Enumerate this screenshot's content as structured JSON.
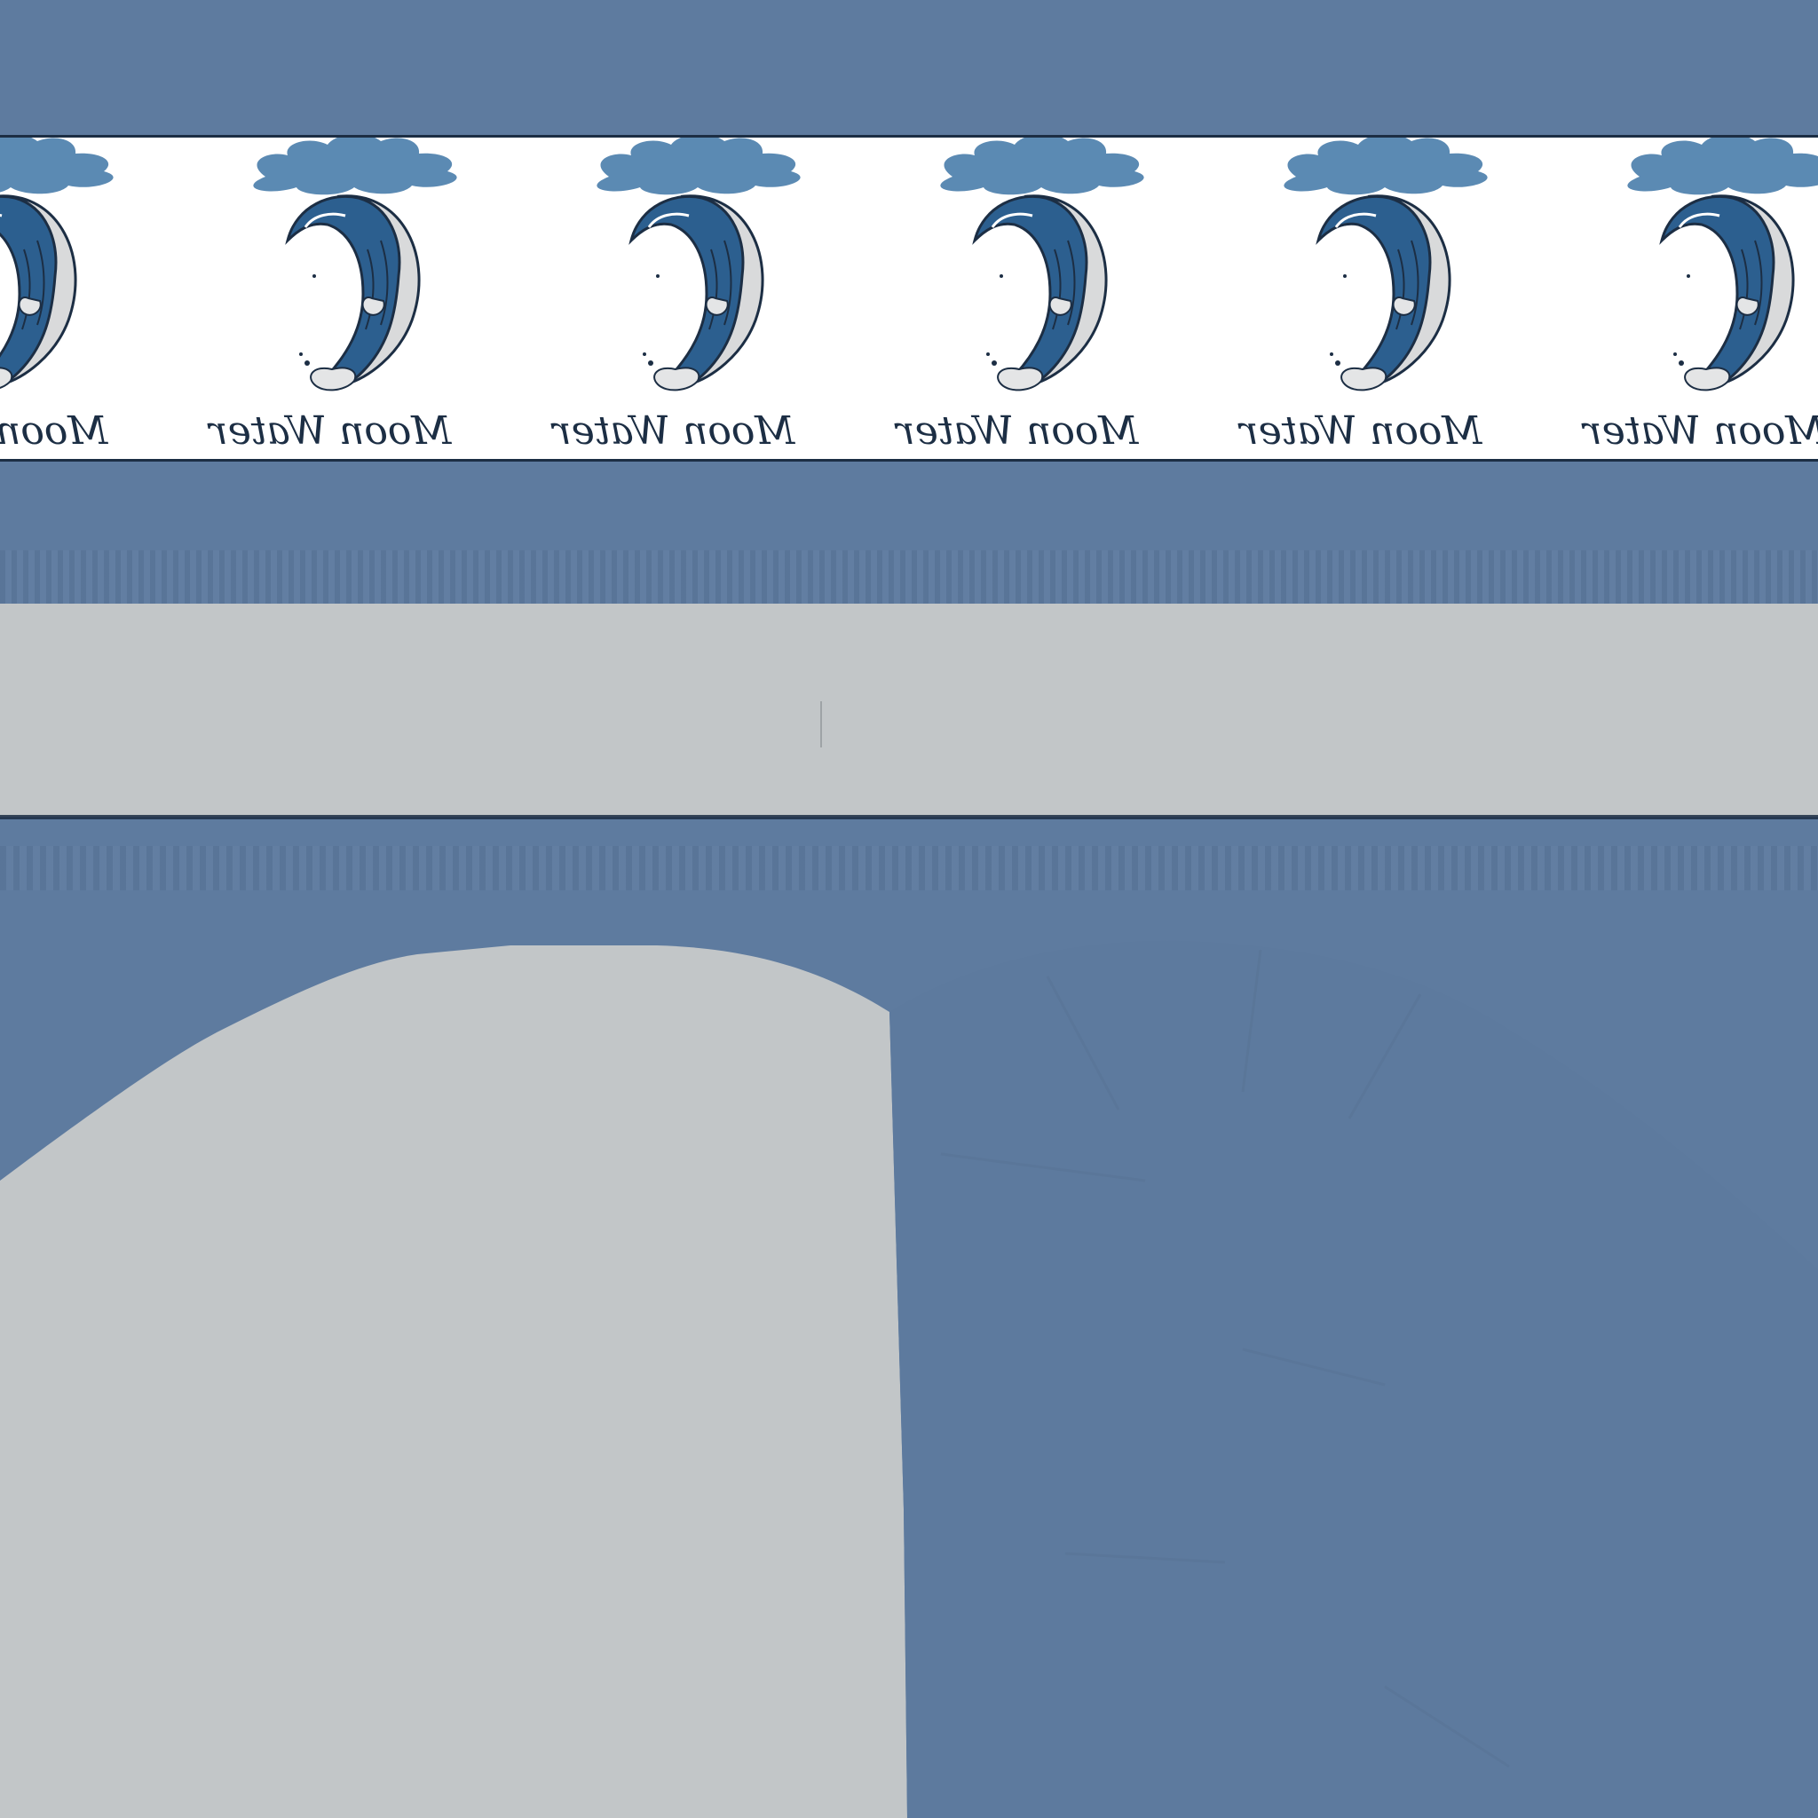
{
  "pattern": {
    "motif_label": "Moon Water",
    "motif_label_mirrored": true,
    "repeat_count": 6
  },
  "colors": {
    "fabric_blue": "#5e7b9f",
    "print_background": "#ffffff",
    "wave_blue": "#2c5f8f",
    "cloud_blue": "#5b8ab3",
    "moon_grey": "#d9dadb",
    "outline_navy": "#1c2e44",
    "panel_grey": "#c2c6c8"
  },
  "icons": {
    "motif": "moon-wave-icon",
    "cloud": "cloud-icon"
  }
}
